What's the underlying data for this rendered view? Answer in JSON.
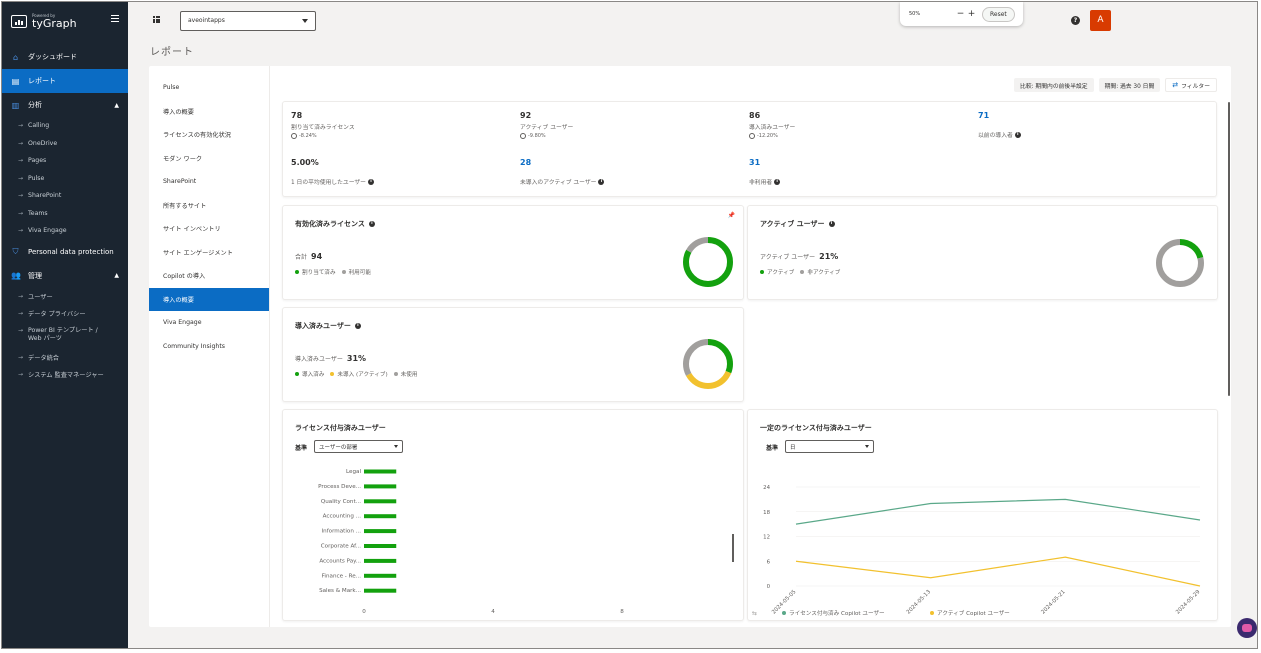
{
  "brand": {
    "small": "Powered by",
    "name": "tyGraph",
    "icon": "tygraph-logo-icon"
  },
  "sidebar": {
    "items": [
      {
        "label": "ダッシュボード",
        "icon": "home-icon"
      },
      {
        "label": "レポート",
        "icon": "report-icon",
        "active": true
      },
      {
        "label": "分析",
        "icon": "analytics-icon",
        "expandable": true
      },
      {
        "label": "Personal data protection",
        "icon": "shield-icon"
      },
      {
        "label": "管理",
        "icon": "users-icon",
        "expandable": true
      }
    ],
    "analytics_children": [
      "Calling",
      "OneDrive",
      "Pages",
      "Pulse",
      "SharePoint",
      "Teams",
      "Viva Engage"
    ],
    "admin_children": [
      "ユーザー",
      "データ プライバシー",
      "Power BI テンプレート / Web パーツ",
      "データ統合",
      "システム 監査マネージャー"
    ]
  },
  "topbar": {
    "tenant": "aveointapps",
    "zoom": {
      "percent": "50%",
      "minus": "−",
      "plus": "+",
      "reset": "Reset"
    },
    "avatar": "A"
  },
  "page_title": "レポート",
  "subnav": [
    {
      "label": "Pulse"
    },
    {
      "label": "導入の概要"
    },
    {
      "label": "ライセンスの有効化状況"
    },
    {
      "label": "モダン ワーク"
    },
    {
      "label": "SharePoint"
    },
    {
      "label": "所有するサイト"
    },
    {
      "label": "サイト インベントリ"
    },
    {
      "label": "サイト エンゲージメント"
    },
    {
      "label": "Copilot の導入"
    },
    {
      "label": "導入の概要",
      "active": true
    },
    {
      "label": "Viva Engage"
    },
    {
      "label": "Community Insights"
    }
  ],
  "filters": {
    "compare": "比較: 期間内の前後半設定",
    "period": "期間: 過去 30 日間",
    "filter": "フィルター"
  },
  "stats": [
    {
      "value": "78",
      "label": "割り当て済みライセンス",
      "change": "-8.24%"
    },
    {
      "value": "92",
      "label": "アクティブ ユーザー",
      "change": "-9.80%"
    },
    {
      "value": "86",
      "label": "導入済みユーザー",
      "change": "-12.20%"
    },
    {
      "value": "71",
      "label": "以前の導入者",
      "link": true
    },
    {
      "value": "5.00%",
      "label": "1 日の平均使用したユーザー"
    },
    {
      "value": "28",
      "label": "未導入のアクティブ ユーザー",
      "link": true
    },
    {
      "value": "31",
      "label": "非利用者",
      "link": true
    }
  ],
  "licenses_card": {
    "title": "有効化済みライセンス",
    "caption": "合計",
    "value": "94",
    "legend": [
      "割り当て済み",
      "利用可能"
    ],
    "assigned_fraction": 0.83,
    "colors": [
      "#13a10e",
      "#a19f9d"
    ]
  },
  "active_card": {
    "title": "アクティブ ユーザー",
    "caption": "アクティブ ユーザー",
    "value": "21%",
    "legend": [
      "アクティブ",
      "非アクティブ"
    ],
    "active_fraction": 0.21,
    "colors": [
      "#13a10e",
      "#a19f9d"
    ]
  },
  "adopted_card": {
    "title": "導入済みユーザー",
    "caption": "導入済みユーザー",
    "value": "31%",
    "legend": [
      "導入済み",
      "未導入 (アクティブ)",
      "未使用"
    ],
    "fractions": [
      0.31,
      0.36,
      0.33
    ],
    "colors": [
      "#13a10e",
      "#f2c12e",
      "#a19f9d"
    ]
  },
  "bar_card": {
    "title": "ライセンス付与済みユーザー",
    "select_label": "基準",
    "select_value": "ユーザーの部署"
  },
  "line_card": {
    "title": "一定のライセンス付与済みユーザー",
    "select_label": "基準",
    "select_value": "日"
  },
  "chart_data": [
    {
      "type": "bar",
      "orientation": "horizontal",
      "categories": [
        "Legal",
        "Process Deve...",
        "Quality Cont...",
        "Accounting ...",
        "Information ...",
        "Corporate Af...",
        "Accounts Pay...",
        "Finance - Re...",
        "Sales & Mark..."
      ],
      "values": [
        1,
        1,
        1,
        1,
        1,
        1,
        1,
        1,
        1
      ],
      "xlim": [
        0,
        8
      ],
      "xticks": [
        "0",
        "4",
        "8"
      ],
      "color": "#13a10e"
    },
    {
      "type": "line",
      "x": [
        "2024-05-05",
        "2024-05-13",
        "2024-05-21",
        "2024-05-29"
      ],
      "ylim": [
        0,
        24
      ],
      "yticks": [
        "24",
        "18",
        "12",
        "6",
        "0"
      ],
      "series": [
        {
          "name": "ライセンス付与済み Copilot ユーザー",
          "values": [
            15,
            20,
            21,
            16
          ],
          "color": "#5aa889"
        },
        {
          "name": "アクティブ Copilot ユーザー",
          "values": [
            6,
            2,
            7,
            0
          ],
          "color": "#f2c12e"
        }
      ]
    }
  ]
}
